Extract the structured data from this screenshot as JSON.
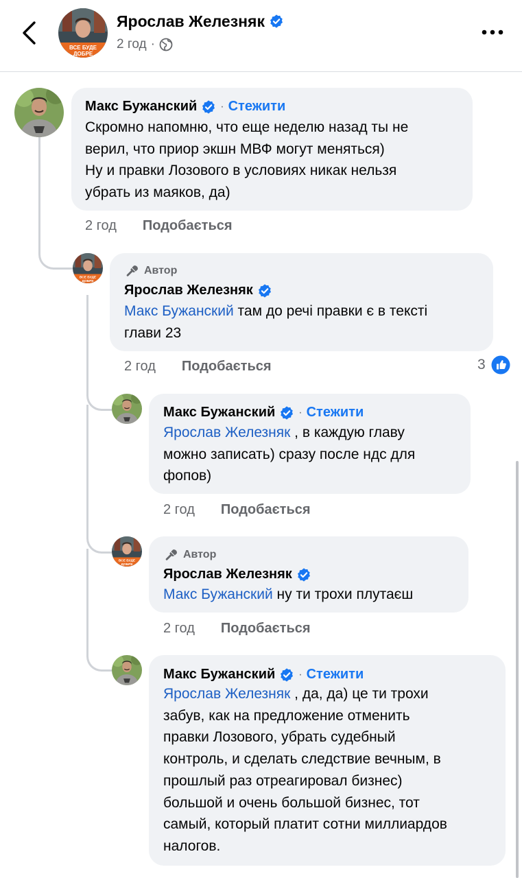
{
  "header": {
    "author_name": "Ярослав Железняк",
    "time": "2 год",
    "separator": "·",
    "avatar_caption": "ВСЕ БУДЕ ДОБРЕ"
  },
  "comments": [
    {
      "name": "Макс Бужанский",
      "separator": "·",
      "follow": "Стежити",
      "lines": [
        "Скромно напомню, что еще неделю назад ты не",
        "верил, что приор экшн МВФ могут меняться)",
        "Ну и правки Лозового в условиях никак нельзя",
        "убрать из маяков, да)"
      ],
      "time": "2 год",
      "like": "Подобається"
    },
    {
      "author_tag": "Автор",
      "name": "Ярослав Железняк",
      "mention": "Макс Бужанский",
      "line1_rest": " там до речі правки є в тексті",
      "line2": "глави 23",
      "time": "2 год",
      "like": "Подобається",
      "reaction_count": "3"
    },
    {
      "name": "Макс Бужанский",
      "separator": "·",
      "follow": "Стежити",
      "mention": "Ярослав Железняк",
      "line1_rest": " , в каждую главу",
      "line2": "можно записать) сразу после ндс для",
      "line3": "фопов)",
      "time": "2 год",
      "like": "Подобається"
    },
    {
      "author_tag": "Автор",
      "name": "Ярослав Железняк",
      "mention": "Макс Бужанский",
      "line1_rest": " ну ти трохи плутаєш",
      "time": "2 год",
      "like": "Подобається"
    },
    {
      "name": "Макс Бужанский",
      "separator": "·",
      "follow": "Стежити",
      "mention": "Ярослав Железняк",
      "line1_rest": " , да, да) це ти трохи",
      "lines": [
        "забув, как на предложение отменить",
        "правки Лозового, убрать судебный",
        "контроль, и сделать следствие вечным, в",
        "прошлый раз отреагировал бизнес)",
        "большой и очень большой бизнес, тот",
        "самый, который платит сотни миллиардов",
        "налогов."
      ]
    }
  ],
  "colors": {
    "verified": "#1877f2",
    "follow": "#1877f2",
    "bubble": "#f0f2f5",
    "mention": "#1d5fc4",
    "muted": "#65676b",
    "avatar_orange": "#f26b1d"
  }
}
